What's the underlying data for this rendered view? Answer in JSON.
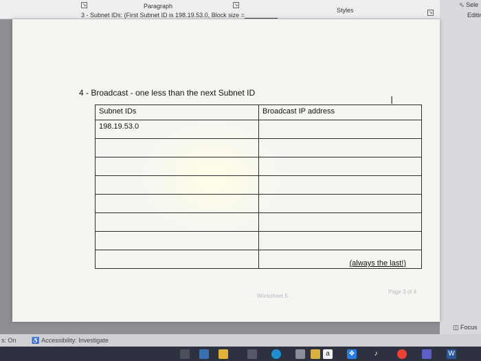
{
  "ribbon": {
    "paragraph_label": "Paragraph",
    "styles_label": "Styles",
    "cut_text": "3 - Subnet IDs: (First Subnet ID is 198.19.53.0, Block size ="
  },
  "right_pane": {
    "select_label": "Sele",
    "editing_label": "Editin"
  },
  "document": {
    "heading": "4 - Broadcast - one less than the next Subnet ID",
    "table": {
      "headers": [
        "Subnet IDs",
        "Broadcast IP address"
      ],
      "rows": [
        [
          "198.19.53.0",
          ""
        ],
        [
          "",
          ""
        ],
        [
          "",
          ""
        ],
        [
          "",
          ""
        ],
        [
          "",
          ""
        ],
        [
          "",
          ""
        ],
        [
          "",
          ""
        ],
        [
          "",
          ""
        ]
      ],
      "last_row_note": "(always the last!)"
    },
    "footer_center": "Worksheet 5",
    "footer_right": "Page 3 of 4"
  },
  "statusbar": {
    "mode": "s: On",
    "accessibility": "Accessibility: Investigate",
    "focus": "Focus"
  },
  "taskbar": {
    "icons": [
      "dark-tile-icon",
      "browser-icon",
      "file-explorer-icon",
      "dark-square-icon",
      "edge-icon",
      "calendar-icon",
      "notes-icon",
      "amazon-icon",
      "dropbox-icon",
      "music-icon",
      "chrome-icon",
      "teams-icon",
      "word-icon"
    ],
    "amazon_letter": "a"
  },
  "colors": {
    "page": "#f6f5f2",
    "background": "#8e8e95",
    "taskbar": "#2e3240"
  }
}
